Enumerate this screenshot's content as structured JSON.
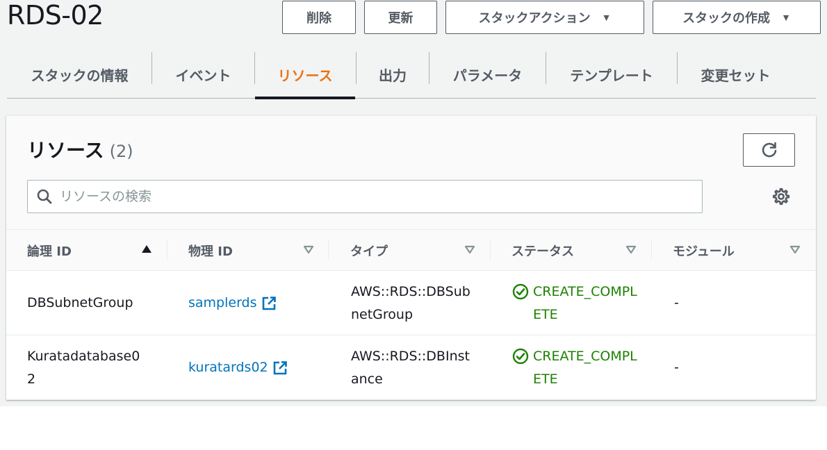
{
  "header": {
    "title": "RDS-02",
    "buttons": {
      "delete": "削除",
      "update": "更新",
      "stack_actions": "スタックアクション",
      "create_stack": "スタックの作成"
    }
  },
  "tabs": [
    {
      "label": "スタックの情報"
    },
    {
      "label": "イベント"
    },
    {
      "label": "リソース",
      "active": true
    },
    {
      "label": "出力"
    },
    {
      "label": "パラメータ"
    },
    {
      "label": "テンプレート"
    },
    {
      "label": "変更セット"
    }
  ],
  "resources": {
    "title": "リソース",
    "count": "(2)",
    "search": {
      "placeholder": "リソースの検索",
      "value": ""
    },
    "columns": [
      {
        "label": "論理 ID",
        "sort": "ascending"
      },
      {
        "label": "物理 ID",
        "sort": "none"
      },
      {
        "label": "タイプ",
        "sort": "none"
      },
      {
        "label": "ステータス",
        "sort": "none"
      },
      {
        "label": "モジュール",
        "sort": "none"
      }
    ],
    "rows": [
      {
        "logical_id": "DBSubnetGroup",
        "physical_id": "samplerds",
        "type": "AWS::RDS::DBSubnetGroup",
        "status": "CREATE_COMPLETE",
        "module": "-"
      },
      {
        "logical_id": "Kuratadatabase02",
        "physical_id": "kuratards02",
        "type": "AWS::RDS::DBInstance",
        "status": "CREATE_COMPLETE",
        "module": "-"
      }
    ]
  },
  "colors": {
    "accent_tab": "#ec7211",
    "link": "#0073bb",
    "status_success": "#1d8102",
    "button_border": "#545b64"
  },
  "icons": {
    "dropdown": "caret-down-icon",
    "refresh": "refresh-icon",
    "search": "search-icon",
    "settings": "gear-icon",
    "external_link": "external-link-icon",
    "status_ok": "check-circle-icon",
    "sort_asc": "sort-ascending-icon",
    "sort_none": "sort-down-outline-icon"
  }
}
